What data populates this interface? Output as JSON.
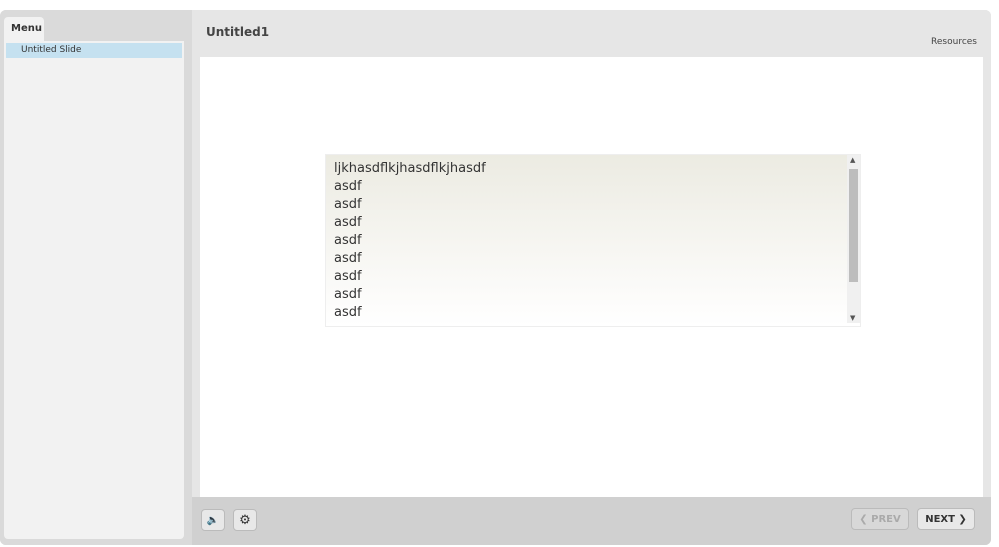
{
  "sidebar": {
    "tab_label": "Menu",
    "items": [
      {
        "label": "Untitled Slide"
      }
    ]
  },
  "header": {
    "title": "Untitled1",
    "resources_label": "Resources"
  },
  "slide": {
    "textbox_lines": "ljkhasdflkjhasdflkjhasdf\nasdf\nasdf\nasdf\nasdf\nasdf\nasdf\nasdf\nasdf\n"
  },
  "controls": {
    "volume_icon": "speaker-icon",
    "settings_icon": "gear-icon",
    "prev_label": "❮ PREV",
    "next_label": "NEXT ❯"
  }
}
